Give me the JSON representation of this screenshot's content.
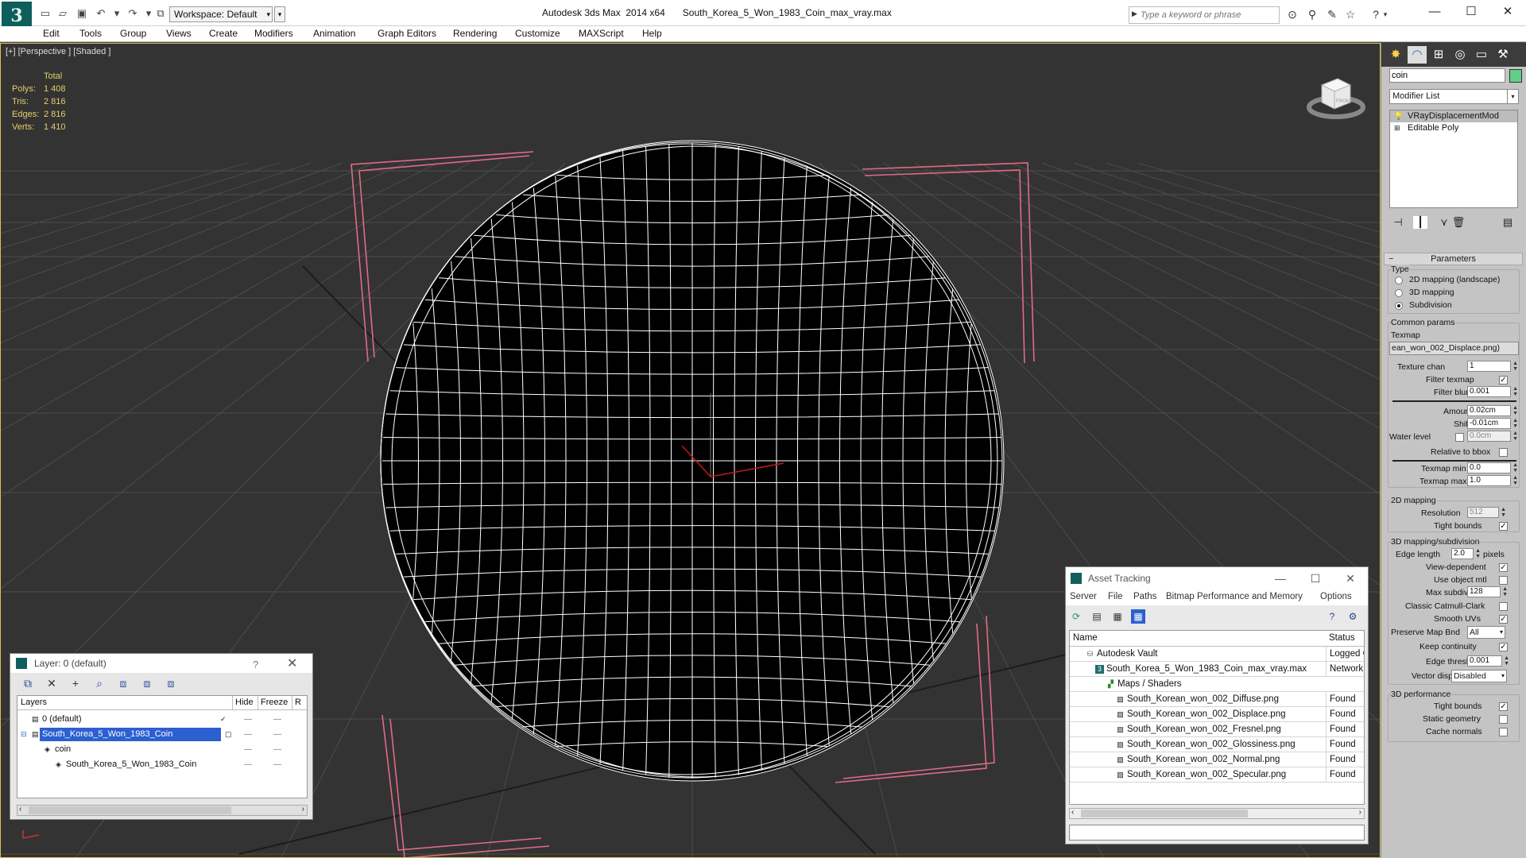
{
  "titlebar": {
    "logo": "3",
    "workspace": "Workspace: Default",
    "app_name": "Autodesk 3ds Max  2014 x64",
    "file_name": "South_Korea_5_Won_1983_Coin_max_vray.max",
    "search_placeholder": "Type a keyword or phrase"
  },
  "menu": [
    "Edit",
    "Tools",
    "Group",
    "Views",
    "Create",
    "Modifiers",
    "Animation",
    "Graph Editors",
    "Rendering",
    "Customize",
    "MAXScript",
    "Help"
  ],
  "viewport": {
    "label": "[+] [Perspective ] [Shaded ]",
    "stats": {
      "header": "Total",
      "rows": [
        {
          "key": "Polys:",
          "value": "1 408"
        },
        {
          "key": "Tris:",
          "value": "2 816"
        },
        {
          "key": "Edges:",
          "value": "2 816"
        },
        {
          "key": "Verts:",
          "value": "1 410"
        }
      ]
    },
    "viewcube_label": "FRONT"
  },
  "command_panel": {
    "object_name": "coin",
    "object_color": "#5fd08a",
    "modifier_list": "Modifier List",
    "stack": [
      {
        "label": "VRayDisplacementMod",
        "selected": true,
        "icon": "light-bulb-icon"
      },
      {
        "label": "Editable Poly",
        "selected": false,
        "icon": "plus-icon"
      }
    ],
    "params": {
      "header": "Parameters",
      "type_label": "Type",
      "type_options": [
        {
          "label": "2D mapping (landscape)",
          "checked": false
        },
        {
          "label": "3D mapping",
          "checked": false
        },
        {
          "label": "Subdivision",
          "checked": true
        }
      ],
      "common_label": "Common params",
      "texmap_label": "Texmap",
      "texmap_value": "ean_won_002_Displace.png)",
      "texture_chan_label": "Texture chan",
      "texture_chan_value": "1",
      "filter_texmap_label": "Filter texmap",
      "filter_blur_label": "Filter blur",
      "filter_blur_value": "0.001",
      "amount_label": "Amount",
      "amount_value": "0.02cm",
      "shift_label": "Shift",
      "shift_value": "-0.01cm",
      "water_label": "Water level",
      "water_value": "0.0cm",
      "relative_bbox_label": "Relative to bbox",
      "texmap_min_label": "Texmap min",
      "texmap_min_value": "0.0",
      "texmap_max_label": "Texmap max",
      "texmap_max_value": "1.0",
      "mapping2d_label": "2D mapping",
      "resolution_label": "Resolution",
      "resolution_value": "512",
      "tight_bounds_label": "Tight bounds",
      "subdiv_label": "3D mapping/subdivision",
      "edge_length_label": "Edge length",
      "edge_length_value": "2.0",
      "pixels_label": "pixels",
      "view_dependent_label": "View-dependent",
      "use_object_mtl_label": "Use object mtl",
      "max_subdivs_label": "Max subdivs",
      "max_subdivs_value": "128",
      "classic_label": "Classic Catmull-Clark",
      "smooth_uvs_label": "Smooth UVs",
      "preserve_label": "Preserve Map Bnd",
      "preserve_value": "All",
      "keep_continuity_label": "Keep continuity",
      "edge_thresh_label": "Edge thresh",
      "edge_thresh_value": "0.001",
      "vector_displ_label": "Vector displ",
      "vector_displ_value": "Disabled",
      "perf_label": "3D performance",
      "perf_tight_label": "Tight bounds",
      "static_geo_label": "Static geometry",
      "cache_normals_label": "Cache normals"
    }
  },
  "layer_dialog": {
    "title": "Layer: 0 (default)",
    "help": "?",
    "columns": [
      "Layers",
      "Hide",
      "Freeze",
      "R"
    ],
    "rows": [
      {
        "name": "0 (default)",
        "indent": 0,
        "selected": false,
        "mark": "✓"
      },
      {
        "name": "South_Korea_5_Won_1983_Coin",
        "indent": 0,
        "selected": true,
        "mark": "▢"
      },
      {
        "name": "coin",
        "indent": 1,
        "selected": false,
        "mark": ""
      },
      {
        "name": "South_Korea_5_Won_1983_Coin",
        "indent": 1,
        "selected": false,
        "mark": ""
      }
    ]
  },
  "asset_dialog": {
    "title": "Asset Tracking",
    "menu": [
      "Server",
      "File",
      "Paths",
      "Bitmap Performance and Memory",
      "Options"
    ],
    "columns": [
      "Name",
      "Status"
    ],
    "rows": [
      {
        "name": "Autodesk Vault",
        "status": "Logged O",
        "indent": 0,
        "icon": "vault-icon"
      },
      {
        "name": "South_Korea_5_Won_1983_Coin_max_vray.max",
        "status": "Network",
        "indent": 1,
        "icon": "max-file-icon"
      },
      {
        "name": "Maps / Shaders",
        "status": "",
        "indent": 2,
        "icon": "maps-folder-icon"
      },
      {
        "name": "South_Korean_won_002_Diffuse.png",
        "status": "Found",
        "indent": 3,
        "icon": "image-file-icon"
      },
      {
        "name": "South_Korean_won_002_Displace.png",
        "status": "Found",
        "indent": 3,
        "icon": "image-file-icon"
      },
      {
        "name": "South_Korean_won_002_Fresnel.png",
        "status": "Found",
        "indent": 3,
        "icon": "image-file-icon"
      },
      {
        "name": "South_Korean_won_002_Glossiness.png",
        "status": "Found",
        "indent": 3,
        "icon": "image-file-icon"
      },
      {
        "name": "South_Korean_won_002_Normal.png",
        "status": "Found",
        "indent": 3,
        "icon": "image-file-icon"
      },
      {
        "name": "South_Korean_won_002_Specular.png",
        "status": "Found",
        "indent": 3,
        "icon": "image-file-icon"
      }
    ]
  },
  "colors": {
    "viewport_bg": "#333333",
    "wire": "#ffffff",
    "bbox": "#e06a88",
    "stats_text": "#e6cf68",
    "selection": "#2c5fd0",
    "object_color": "#5fd08a"
  }
}
